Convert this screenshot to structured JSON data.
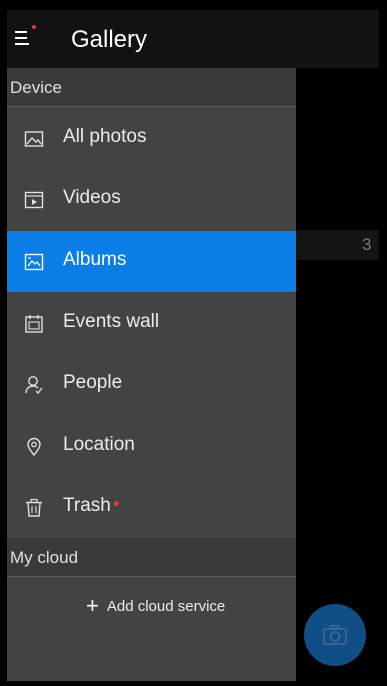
{
  "app": {
    "title": "Gallery"
  },
  "drawer": {
    "device_header": "Device",
    "items": [
      {
        "label": "All photos",
        "icon": "photo-icon"
      },
      {
        "label": "Videos",
        "icon": "video-icon"
      },
      {
        "label": "Albums",
        "icon": "album-icon",
        "active": true
      },
      {
        "label": "Events wall",
        "icon": "events-icon"
      },
      {
        "label": "People",
        "icon": "person-icon"
      },
      {
        "label": "Location",
        "icon": "location-pin-icon"
      },
      {
        "label": "Trash",
        "icon": "trash-icon",
        "badge": "red-dot"
      }
    ],
    "cloud_header": "My cloud",
    "add_cloud": "Add cloud service"
  },
  "background": {
    "album_count": "3"
  },
  "colors": {
    "accent": "#0a7de6",
    "notification": "#e53935",
    "fab": "#0f4f86"
  }
}
